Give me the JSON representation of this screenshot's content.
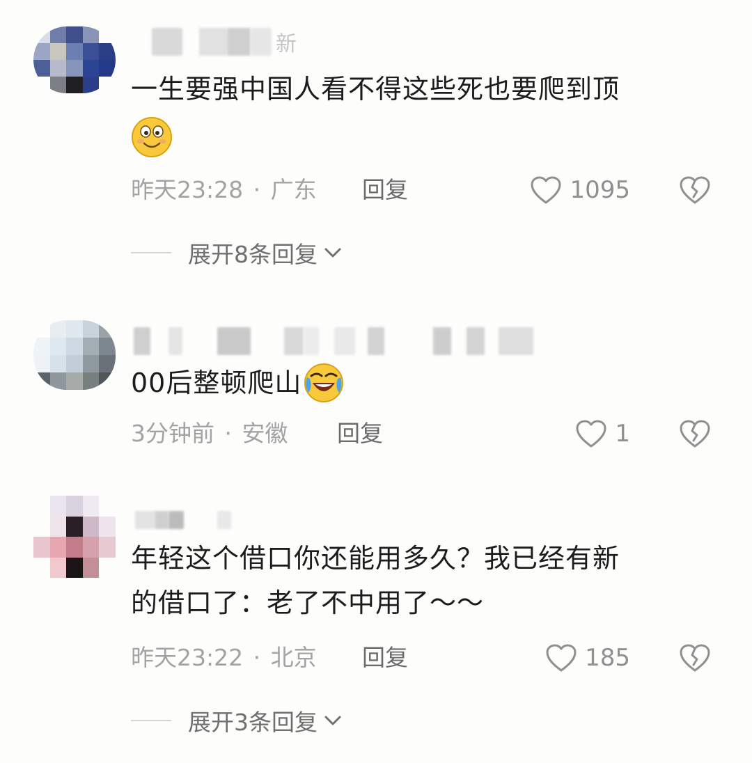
{
  "comments": [
    {
      "username_suffix": "新",
      "text_line1": "一生要强中国人看不得这些死也要爬到顶",
      "emoji": "smile-emoji",
      "time": "昨天23:28",
      "sep": "·",
      "location": "广东",
      "reply_label": "回复",
      "likes": "1095",
      "expand_label": "展开8条回复"
    },
    {
      "text_line1": "00后整顿爬山",
      "emoji": "laughing-crying-emoji",
      "time": "3分钟前",
      "sep": "·",
      "location": "安徽",
      "reply_label": "回复",
      "likes": "1"
    },
    {
      "text_line1": "年轻这个借口你还能用多久？我已经有新",
      "text_line2": "的借口了：老了不中用了～～",
      "time": "昨天23:22",
      "sep": "·",
      "location": "北京",
      "reply_label": "回复",
      "likes": "185",
      "expand_label": "展开3条回复"
    }
  ],
  "icons": {
    "like": "heart-outline-icon",
    "dislike": "broken-heart-icon",
    "expand": "chevron-down-icon"
  },
  "colors": {
    "background": "#fdfdfb",
    "text": "#1c1c1c",
    "meta": "#a3a3a3"
  }
}
